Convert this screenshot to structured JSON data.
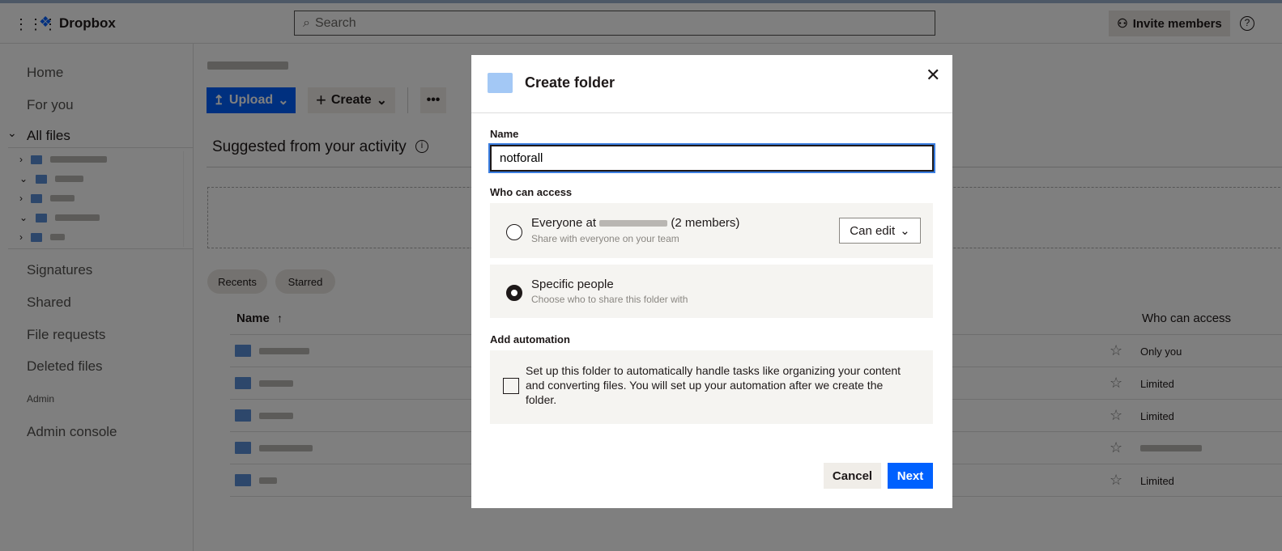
{
  "topbar": {
    "brand": "Dropbox",
    "search_placeholder": "Search",
    "invite_label": "Invite members"
  },
  "sidebar": {
    "items": [
      "Home",
      "For you",
      "All files",
      "Signatures",
      "Shared",
      "File requests",
      "Deleted files"
    ],
    "admin_heading": "Admin",
    "admin_console": "Admin console"
  },
  "main": {
    "upload_label": "Upload",
    "create_label": "Create",
    "suggested_title": "Suggested from your activity",
    "filters": [
      "Recents",
      "Starred"
    ],
    "table": {
      "col_name": "Name",
      "col_access": "Who can access",
      "rows": [
        {
          "access": "Only you"
        },
        {
          "access": "Limited"
        },
        {
          "access": "Limited"
        },
        {
          "access": ""
        },
        {
          "access": "Limited"
        }
      ]
    }
  },
  "dialog": {
    "title": "Create folder",
    "name_label": "Name",
    "name_value": "notforall",
    "access_label": "Who can access",
    "options": [
      {
        "title_prefix": "Everyone at",
        "title_suffix": "(2 members)",
        "subtitle": "Share with everyone on your team",
        "selected": false,
        "permission": "Can edit"
      },
      {
        "title": "Specific people",
        "subtitle": "Choose who to share this folder with",
        "selected": true
      }
    ],
    "automation_label": "Add automation",
    "automation_text": "Set up this folder to automatically handle tasks like organizing your content and converting files. You will set up your automation after we create the folder.",
    "automation_checked": false,
    "cancel_label": "Cancel",
    "next_label": "Next"
  },
  "colors": {
    "accent": "#0061fe",
    "upload": "#0061fe",
    "folder": "#a3c8f5"
  }
}
